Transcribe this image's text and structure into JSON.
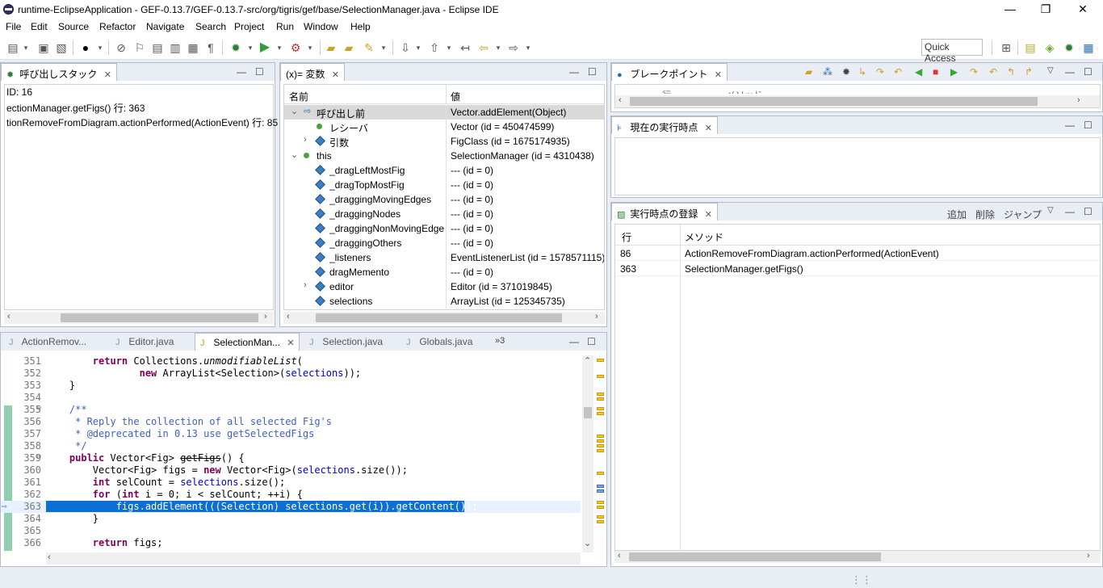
{
  "window": {
    "title": "runtime-EclipseApplication - GEF-0.13.7/GEF-0.13.7-src/org/tigris/gef/base/SelectionManager.java - Eclipse IDE",
    "minimize": "—",
    "restore": "❐",
    "close": "✕"
  },
  "menu": [
    "File",
    "Edit",
    "Source",
    "Refactor",
    "Navigate",
    "Search",
    "Project",
    "Run",
    "Window",
    "Help"
  ],
  "quick_access": "Quick Access",
  "callstack": {
    "tab_label": "呼び出しスタック",
    "rows": [
      "ID: 16",
      "ectionManager.getFigs() 行: 363",
      "tionRemoveFromDiagram.actionPerformed(ActionEvent) 行: 85"
    ]
  },
  "variables": {
    "tab_label": "(x)= 変数",
    "col_name": "名前",
    "col_value": "値",
    "rows": [
      {
        "name": "呼び出し前",
        "value": "Vector.addElement(Object)"
      },
      {
        "name": "レシーバ",
        "value": "Vector (id = 450474599)"
      },
      {
        "name": "引数",
        "value": "FigClass (id = 1675174935)"
      },
      {
        "name": "this",
        "value": "SelectionManager (id = 4310438)"
      },
      {
        "name": "_dragLeftMostFig",
        "value": "--- (id = 0)"
      },
      {
        "name": "_dragTopMostFig",
        "value": "--- (id = 0)"
      },
      {
        "name": "_draggingMovingEdges",
        "value": "--- (id = 0)"
      },
      {
        "name": "_draggingNodes",
        "value": "--- (id = 0)"
      },
      {
        "name": "_draggingNonMovingEdge",
        "value": "--- (id = 0)"
      },
      {
        "name": "_draggingOthers",
        "value": "--- (id = 0)"
      },
      {
        "name": "_listeners",
        "value": "EventListenerList (id = 1578571115)"
      },
      {
        "name": "dragMemento",
        "value": "--- (id = 0)"
      },
      {
        "name": "editor",
        "value": "Editor (id = 371019845)"
      },
      {
        "name": "selections",
        "value": "ArrayList (id = 125345735)"
      }
    ]
  },
  "breakpoints": {
    "tab_label": "ブレークポイント",
    "hdr1": "行",
    "hdr2": "メソッド"
  },
  "current_point": {
    "tab_label": "現在の実行時点"
  },
  "registry": {
    "tab_label": "実行時点の登録",
    "add": "追加",
    "delete": "削除",
    "jump": "ジャンプ",
    "col_line": "行",
    "col_method": "メソッド",
    "rows": [
      {
        "line": "86",
        "method": "ActionRemoveFromDiagram.actionPerformed(ActionEvent)"
      },
      {
        "line": "363",
        "method": "SelectionManager.getFigs()"
      }
    ]
  },
  "editor": {
    "tabs": [
      "ActionRemov...",
      "Editor.java",
      "SelectionMan...",
      "Selection.java",
      "Globals.java"
    ],
    "overflow": "»3",
    "lines": [
      {
        "n": "351",
        "html": "        <span class=\"kw\">return</span> Collections.<span class=\"itl\">unmodifiableList</span>("
      },
      {
        "n": "352",
        "html": "                <span class=\"kw\">new</span> ArrayList&lt;Selection&gt;(<span class=\"fld\">selections</span>));"
      },
      {
        "n": "353",
        "html": "    }"
      },
      {
        "n": "354",
        "html": ""
      },
      {
        "n": "355",
        "html": "    <span class=\"cm\">/**</span>"
      },
      {
        "n": "356",
        "html": "<span class=\"cm\">     * Reply the collection of all selected Fig's</span>"
      },
      {
        "n": "357",
        "html": "<span class=\"cm\">     * @deprecated in 0.13 use getSelectedFigs</span>"
      },
      {
        "n": "358",
        "html": "<span class=\"cm\">     */</span>"
      },
      {
        "n": "359",
        "html": "    <span class=\"kw\">public</span> Vector&lt;Fig&gt; <span class=\"strike\">getFigs</span>() {"
      },
      {
        "n": "360",
        "html": "        Vector&lt;Fig&gt; figs = <span class=\"kw\">new</span> Vector&lt;Fig&gt;(<span class=\"fld\">selections</span>.size());"
      },
      {
        "n": "361",
        "html": "        <span class=\"kw\">int</span> selCount = <span class=\"fld\">selections</span>.size();"
      },
      {
        "n": "362",
        "html": "        <span class=\"kw\">for</span> (<span class=\"kw\">int</span> i = 0; i &lt; selCount; ++i) {"
      },
      {
        "n": "363",
        "html": "            figs.addElement(((Selection) selections.get(i)).getContent());"
      },
      {
        "n": "364",
        "html": "        }"
      },
      {
        "n": "365",
        "html": ""
      },
      {
        "n": "366",
        "html": "        <span class=\"kw\">return</span> figs;"
      }
    ]
  }
}
